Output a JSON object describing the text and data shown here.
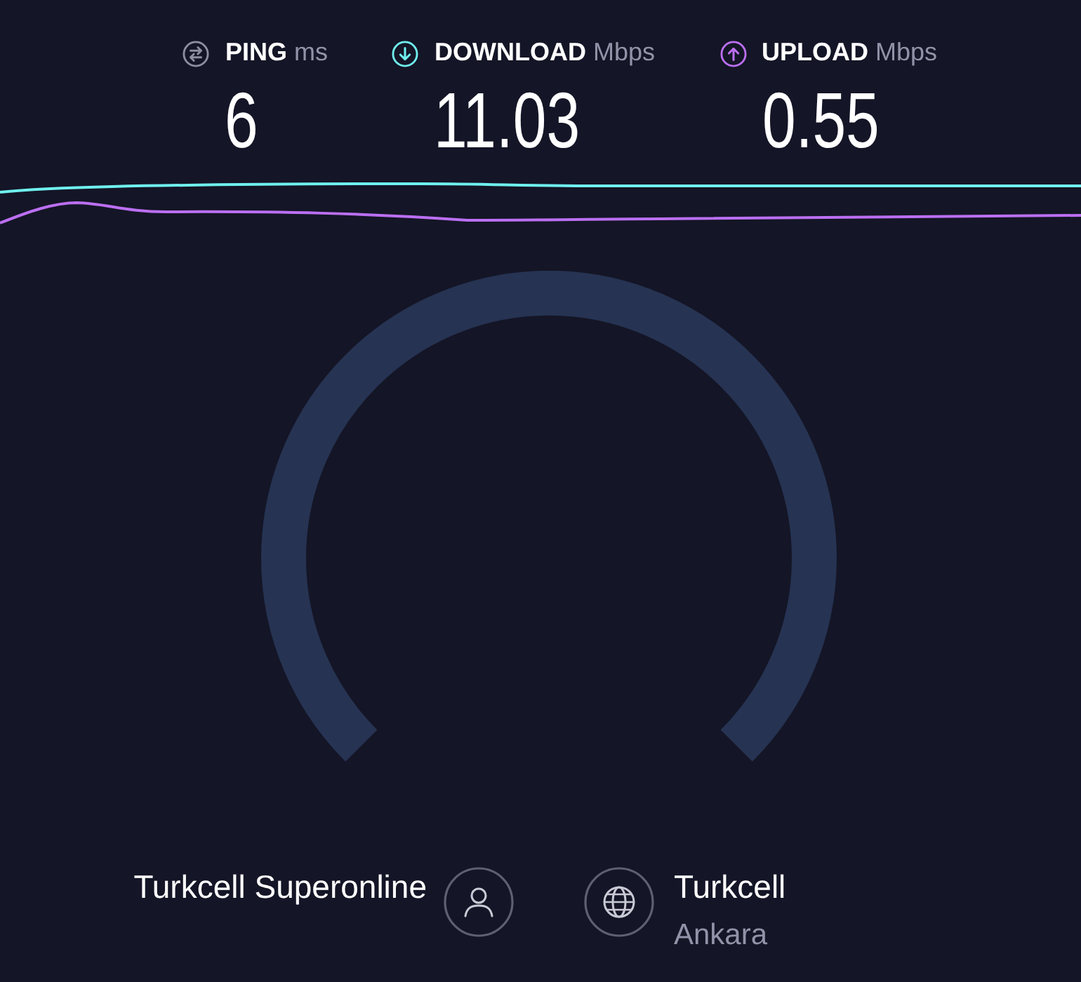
{
  "metrics": [
    {
      "kind": "ping",
      "label": "PING",
      "unit": "ms",
      "value": "6",
      "color": "#8d8fa0"
    },
    {
      "kind": "download",
      "label": "DOWNLOAD",
      "unit": "Mbps",
      "value": "11.03",
      "color": "#6ff0ee"
    },
    {
      "kind": "upload",
      "label": "UPLOAD",
      "unit": "Mbps",
      "value": "0.55",
      "color": "#bb6ff2"
    }
  ],
  "provider": {
    "name": "Turkcell Superonline"
  },
  "server": {
    "name": "Turkcell",
    "location": "Ankara"
  }
}
